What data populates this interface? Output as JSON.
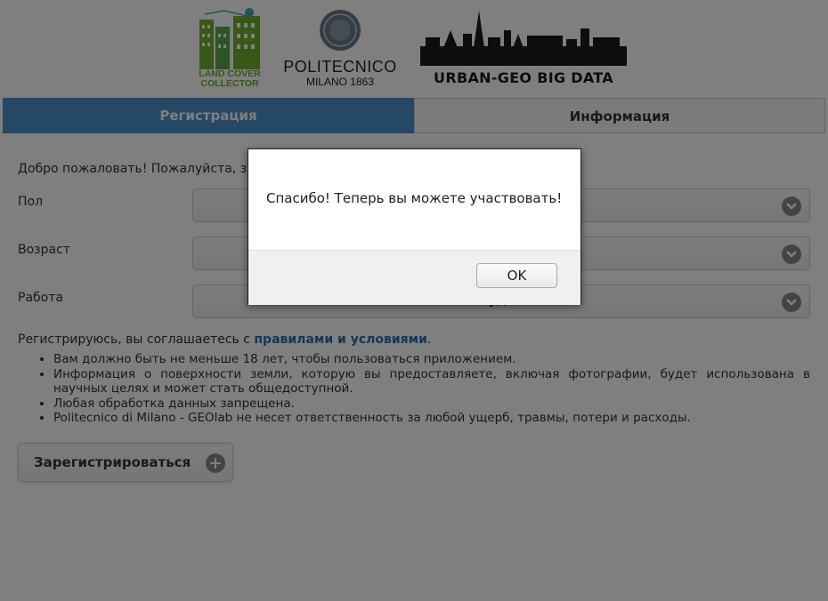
{
  "header": {
    "logo_lcc": "LAND COVER COLLECTOR",
    "logo_lcc_line1": "LAND COVER",
    "logo_lcc_line2": "COLLECTOR",
    "logo_polimi_name": "POLITECNICO",
    "logo_polimi_sub": "MILANO 1863",
    "logo_urban": "URBAN-GEO BIG DATA"
  },
  "tabs": [
    {
      "label": "Регистрация",
      "active": true
    },
    {
      "label": "Информация",
      "active": false
    }
  ],
  "form": {
    "welcome": "Добро пожаловать! Пожалуйста, за",
    "fields": [
      {
        "label": "Пол",
        "value": ""
      },
      {
        "label": "Возраст",
        "value": ""
      },
      {
        "label": "Работа",
        "value": "Студент"
      }
    ],
    "terms_prefix": "Регистрируюсь, вы соглашаетесь с ",
    "terms_link": "правилами и условиями",
    "terms_suffix": ".",
    "rules": [
      "Вам должно быть не меньше 18 лет, чтобы пользоваться приложением.",
      "Информация о поверхности земли, которую вы предоставляете, включая фотографии, будет использована в научных целях и может стать общедоступной.",
      "Любая обработка данных запрещена.",
      "Politecnico di Milano - GEOlab не несет ответственность за любой ущерб, травмы, потери и расходы."
    ],
    "register_button": "Зарегистрироваться"
  },
  "dialog": {
    "message": "Спасибо! Теперь вы можете участвовать!",
    "ok_label": "OK"
  },
  "colors": {
    "tab_active": "#4a90c9",
    "link": "#2a6fb0",
    "lcc_green": "#6fb02c"
  }
}
